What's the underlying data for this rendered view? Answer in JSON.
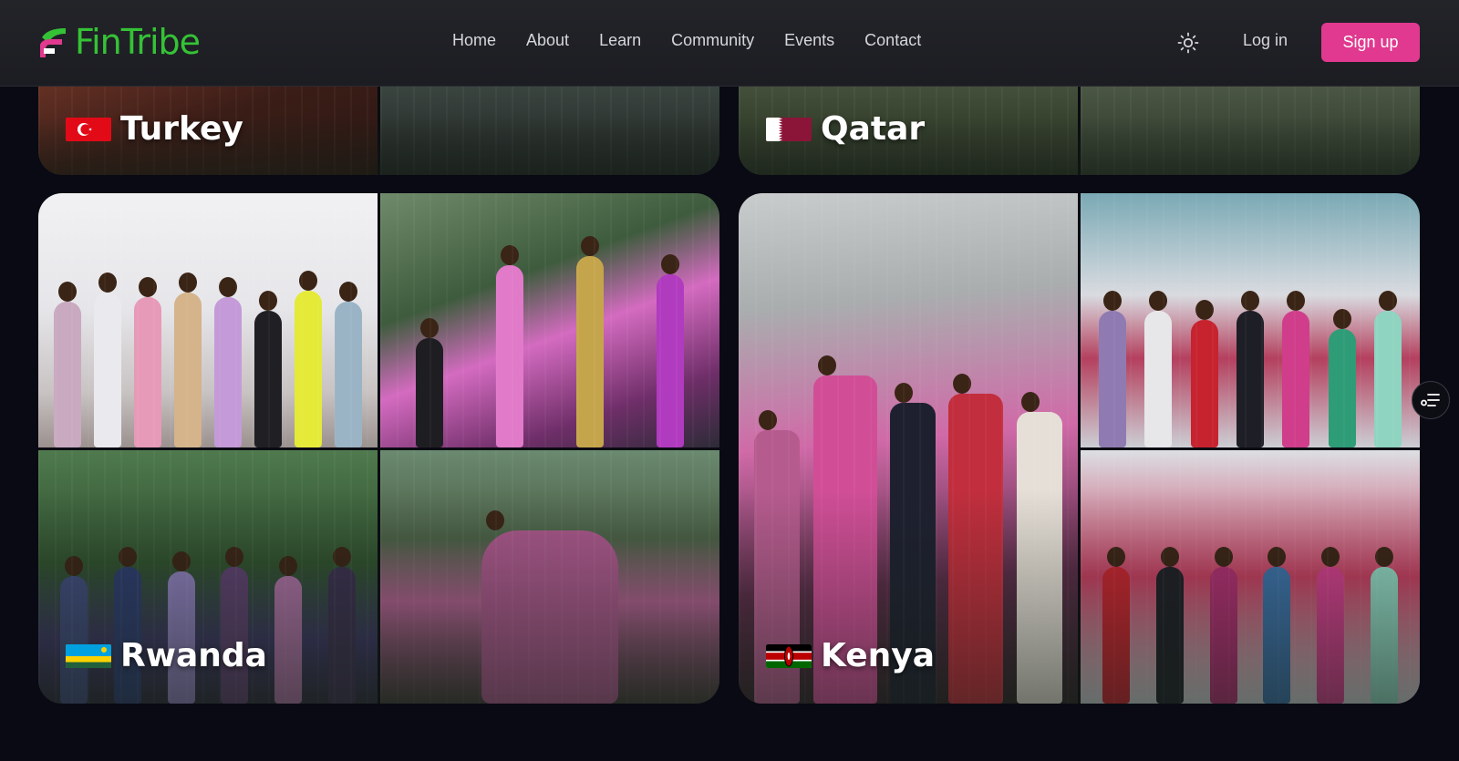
{
  "brand": {
    "name": "FinTribe",
    "accent": "#35c236",
    "cta_color": "#e0398f"
  },
  "nav": {
    "items": [
      {
        "label": "Home"
      },
      {
        "label": "About"
      },
      {
        "label": "Learn"
      },
      {
        "label": "Community"
      },
      {
        "label": "Events"
      },
      {
        "label": "Contact"
      }
    ]
  },
  "header": {
    "theme_icon": "sun-icon",
    "login_label": "Log in",
    "signup_label": "Sign up"
  },
  "destinations": [
    {
      "name": "Turkey",
      "flag": "turkey-flag"
    },
    {
      "name": "Qatar",
      "flag": "qatar-flag"
    },
    {
      "name": "Rwanda",
      "flag": "rwanda-flag"
    },
    {
      "name": "Kenya",
      "flag": "kenya-flag"
    }
  ],
  "floating_button": {
    "icon": "filter-list-icon"
  }
}
